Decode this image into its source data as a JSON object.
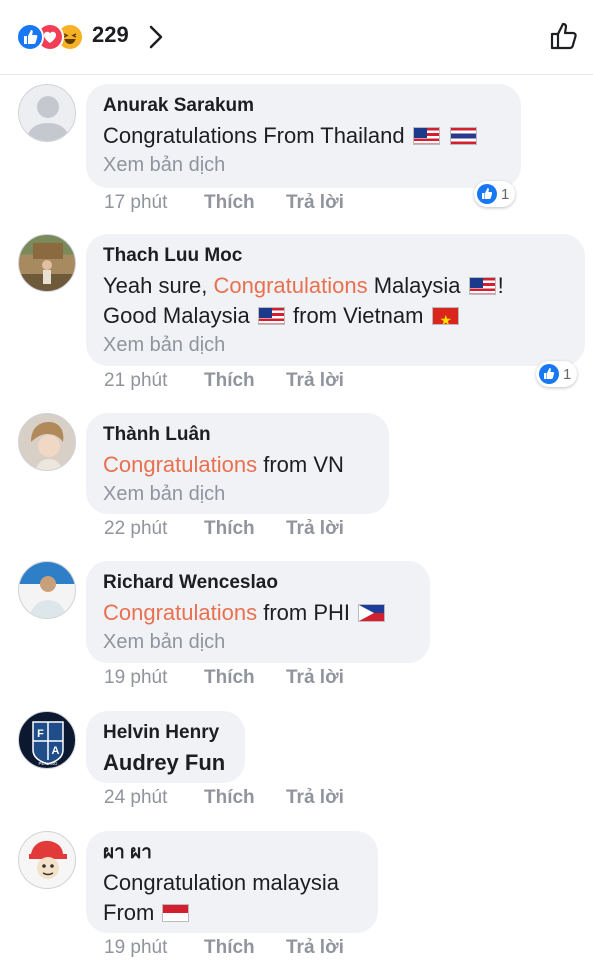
{
  "header": {
    "reaction_count": "229",
    "reaction_icons": [
      "like-icon",
      "love-icon",
      "haha-icon"
    ]
  },
  "labels": {
    "translate": "Xem bản dịch",
    "like": "Thích",
    "reply": "Trả lời"
  },
  "comments": [
    {
      "author": "Anurak Sarakum",
      "text_parts": [
        "Congratulations  From Thailand"
      ],
      "flags": [
        "malaysia-flag",
        "thailand-flag"
      ],
      "time": "17 phút",
      "reaction_count": "1"
    },
    {
      "author": "Thach Luu Moc",
      "text_parts": [
        "Yeah sure, ",
        "Congratulations",
        " Malaysia",
        "!",
        "Good Malaysia",
        "from Vietnam"
      ],
      "flags": [
        "malaysia-flag",
        "malaysia-flag",
        "vietnam-flag"
      ],
      "time": "21 phút",
      "reaction_count": "1"
    },
    {
      "author": "Thành Luân",
      "text_parts": [
        "Congratulations",
        " from VN"
      ],
      "time": "22 phút"
    },
    {
      "author": "Richard Wenceslao",
      "text_parts": [
        "Congratulations",
        " from PHI"
      ],
      "flags": [
        "philippines-flag"
      ],
      "time": "19 phút"
    },
    {
      "author": "Helvin Henry",
      "text_parts": [
        "Audrey Fun"
      ],
      "time": "24 phút",
      "avatar_text": [
        "F",
        "A",
        "PENANG"
      ]
    },
    {
      "author": "ผา ผา",
      "text_parts": [
        "Congratulation malaysia",
        "From"
      ],
      "flags": [
        "indonesia-flag"
      ],
      "time": "19 phút"
    }
  ],
  "colors": {
    "highlight": "#e9704f",
    "like_blue": "#1877f2",
    "bubble_bg": "#f0f2f5",
    "meta_gray": "#90949c"
  }
}
